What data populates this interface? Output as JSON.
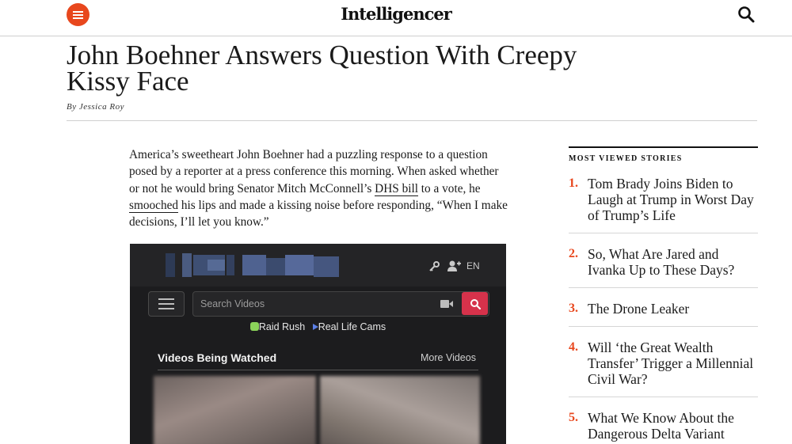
{
  "header": {
    "logo": "Intelligencer",
    "menu_icon": "hamburger-icon",
    "search_icon": "search-icon",
    "accent": "#e8471d"
  },
  "article": {
    "title": "John Boehner Answers Question With Creepy Kissy Face",
    "byline_prefix": "By",
    "author": "Jessica Roy",
    "body": {
      "p1": "America’s sweetheart John Boehner had a puzzling response to a question posed by a reporter at a press conference this morning. When asked whether or not he would bring Senator Mitch McConnell’s ",
      "link1": "DHS bill",
      "p2": " to a vote, he ",
      "link2": "smooched",
      "p3": " his lips and made a kissing noise before responding, “When I make decisions, I’ll let you know.”"
    }
  },
  "video_embed": {
    "lang": "EN",
    "search_placeholder": "Search Videos",
    "link1": "Raid Rush",
    "link2": "Real Life Cams",
    "section_title": "Videos Being Watched",
    "more_link": "More Videos",
    "accent": "#d6324b"
  },
  "sidebar": {
    "heading": "MOST VIEWED STORIES",
    "items": [
      {
        "num": "1.",
        "title": "Tom Brady Joins Biden to Laugh at Trump in Worst Day of Trump’s Life"
      },
      {
        "num": "2.",
        "title": "So, What Are Jared and Ivanka Up to These Days?"
      },
      {
        "num": "3.",
        "title": "The Drone Leaker"
      },
      {
        "num": "4.",
        "title": "Will ‘the Great Wealth Transfer’ Trigger a Millennial Civil War?"
      },
      {
        "num": "5.",
        "title": "What We Know About the Dangerous Delta Variant"
      }
    ]
  }
}
